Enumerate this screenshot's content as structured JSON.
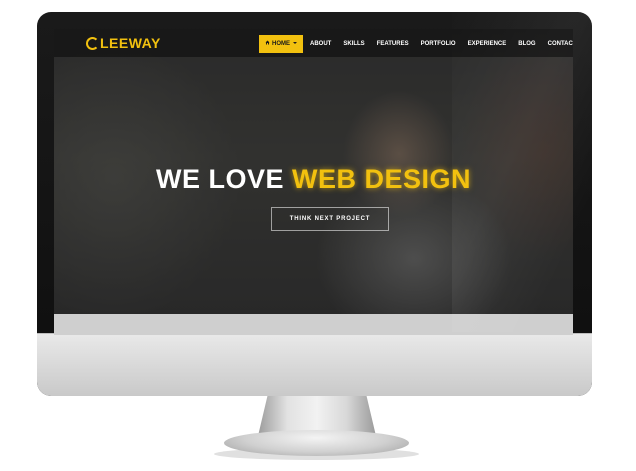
{
  "brand": {
    "logo_text": "LEEWAY",
    "accent_color": "#f2c10f"
  },
  "nav": {
    "items": [
      {
        "label": "HOME",
        "active": true
      },
      {
        "label": "ABOUT",
        "active": false
      },
      {
        "label": "SKILLS",
        "active": false
      },
      {
        "label": "FEATURES",
        "active": false
      },
      {
        "label": "PORTFOLIO",
        "active": false
      },
      {
        "label": "EXPERIENCE",
        "active": false
      },
      {
        "label": "BLOG",
        "active": false
      },
      {
        "label": "CONTACT",
        "active": false
      }
    ],
    "home_icon": "home-icon",
    "home_dropdown_icon": "caret-down-icon"
  },
  "hero": {
    "headline_white": "WE LOVE",
    "headline_yellow": "WEB DESIGN",
    "cta_label": "THINK NEXT PROJECT"
  }
}
